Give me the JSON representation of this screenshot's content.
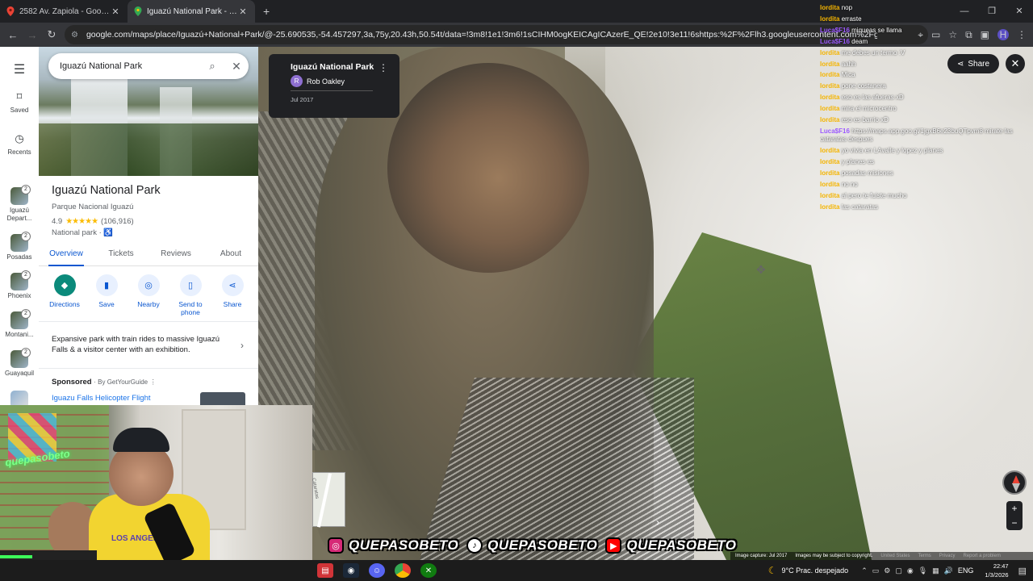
{
  "browser": {
    "tabs": [
      {
        "title": "2582 Av. Zapiola - Google Maps",
        "active": false
      },
      {
        "title": "Iguazú National Park - Google M",
        "active": true
      }
    ],
    "new_tab": "+",
    "url": "google.com/maps/place/Iguazú+National+Park/@-25.690535,-54.457297,3a,75y,20.43h,50.54t/data=!3m8!1e1!3m6!1sCIHM0ogKEICAgICAzerE_QE!2e10!3e11!6shttps:%2F%2Flh3.googleusercontent.com%2Fgpms-cs-s%2FAFfmt2bL6eGj..."
  },
  "rail": {
    "items": [
      {
        "label": "Saved",
        "icon": "bookmark-icon"
      },
      {
        "label": "Recents",
        "icon": "history-icon"
      }
    ],
    "recents": [
      {
        "label": "Iguazú Depart...",
        "badge": "2"
      },
      {
        "label": "Posadas",
        "badge": "2"
      },
      {
        "label": "Phoenix",
        "badge": "2"
      },
      {
        "label": "Montani...",
        "badge": "2"
      },
      {
        "label": "Guayaquil",
        "badge": "2"
      }
    ]
  },
  "panel": {
    "search": {
      "value": "Iguazú National Park"
    },
    "title": "Iguazú National Park",
    "subtitle": "Parque Nacional Iguazú",
    "rating": "4.9",
    "stars": "★★★★★",
    "reviews_count": "(106,916)",
    "category": "National park · ♿",
    "tabs": [
      "Overview",
      "Tickets",
      "Reviews",
      "About"
    ],
    "actions": [
      {
        "label": "Directions",
        "icon": "◆"
      },
      {
        "label": "Save",
        "icon": "▮"
      },
      {
        "label": "Nearby",
        "icon": "◎"
      },
      {
        "label": "Send to phone",
        "icon": "▯"
      },
      {
        "label": "Share",
        "icon": "⋖"
      }
    ],
    "description": "Expansive park with train rides to massive Iguazú Falls & a visitor center with an exhibition.",
    "sponsored_label": "Sponsored",
    "sponsored_by": "· By GetYourGuide",
    "sponsored_more": "⋮",
    "ad_title": "Iguazu Falls Helicopter Flight"
  },
  "streetview": {
    "card_title": "Iguazú National Park",
    "author_initial": "R",
    "author": "Rob Oakley",
    "date": "Jul 2017",
    "share_label": "Share",
    "minimap_label": "Cataratas",
    "footer": [
      "Image capture: Jul 2017",
      "Images may be subject to copyright.",
      "United States",
      "Terms",
      "Privacy",
      "Report a problem"
    ]
  },
  "chat": [
    {
      "user": "lordita",
      "text": "nop",
      "color": "u1"
    },
    {
      "user": "lordita",
      "text": "erraste",
      "color": "u1"
    },
    {
      "user": "Luca$F16",
      "text": "miqueas se llama",
      "color": "u2"
    },
    {
      "user": "Luca$F16",
      "text": "deam",
      "color": "u2"
    },
    {
      "user": "lordita",
      "text": "me debes un termo :V",
      "color": "u1"
    },
    {
      "user": "lordita",
      "text": "aahh",
      "color": "u1"
    },
    {
      "user": "lordita",
      "text": "Mica",
      "color": "u1"
    },
    {
      "user": "lordita",
      "text": "pone costanera",
      "color": "u1"
    },
    {
      "user": "lordita",
      "text": "eso es las afueras xD",
      "color": "u1"
    },
    {
      "user": "lordita",
      "text": "mira el microcentro",
      "color": "u1"
    },
    {
      "user": "lordita",
      "text": "eso es barrio xD",
      "color": "u1"
    },
    {
      "user": "Luca$F16",
      "text": "https://maps.app.goo.gl/1jgxB6e23buQTpvm8 mirate las cataratas despues",
      "color": "u2",
      "wrap": true
    },
    {
      "user": "lordita",
      "text": "yo vivia en LAvalle y lopez y planes",
      "color": "u1"
    },
    {
      "user": "lordita",
      "text": "y planes es",
      "color": "u1"
    },
    {
      "user": "lordita",
      "text": "posadas misiones",
      "color": "u1"
    },
    {
      "user": "lordita",
      "text": "no no",
      "color": "u1"
    },
    {
      "user": "lordita",
      "text": "al pero te fuiste mucho",
      "color": "u1"
    },
    {
      "user": "lordita",
      "text": "las cataratas",
      "color": "u1"
    }
  ],
  "overlay": {
    "handle": "QUEPASOBETO",
    "neon": "quepasobeto",
    "shirt": "LOS ANGELES"
  },
  "taskbar": {
    "weather": "9°C  Prac. despejado",
    "lang": "ENG",
    "time": "22:47",
    "date": "1/3/2026"
  }
}
